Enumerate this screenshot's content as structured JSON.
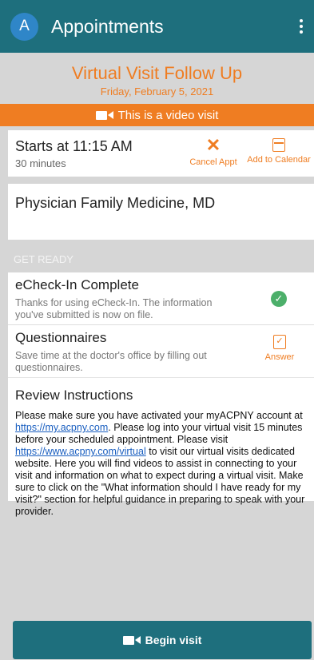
{
  "appbar": {
    "avatar_letter": "A",
    "title": "Appointments"
  },
  "visit": {
    "title": "Virtual Visit Follow Up",
    "date": "Friday, February 5, 2021"
  },
  "video_bar": {
    "label": "This is a video visit"
  },
  "time_card": {
    "starts": "Starts at 11:15 AM",
    "duration": "30 minutes",
    "cancel_label": "Cancel Appt",
    "calendar_label": "Add to Calendar"
  },
  "provider": {
    "name": "Physician Family Medicine, MD"
  },
  "get_ready": {
    "label": "GET READY"
  },
  "echeck": {
    "title": "eCheck-In Complete",
    "subtitle": "Thanks for using eCheck-In. The information you've submitted is now on file."
  },
  "questionnaires": {
    "title": "Questionnaires",
    "subtitle": "Save time at the doctor's office by filling out questionnaires.",
    "answer_label": "Answer"
  },
  "review": {
    "title": "Review Instructions",
    "text_1": "Please make sure you have activated your myACPNY account at ",
    "link_1": "https://my.acpny.com",
    "text_2": ". Please log into your virtual visit 15 minutes before your scheduled appointment. Please visit ",
    "link_2": "https://www.acpny.com/virtual",
    "text_3": " to visit our virtual visits dedicated website. Here you will find videos to assist in connecting to your visit and information on what to expect during a virtual visit. Make sure to click on the \"What information should I have ready for my visit?\" section for helpful guidance in preparing to speak with your provider."
  },
  "begin": {
    "label": "Begin visit"
  },
  "colors": {
    "teal": "#1e6f7d",
    "orange": "#ef7d22",
    "green": "#4caf6a"
  }
}
